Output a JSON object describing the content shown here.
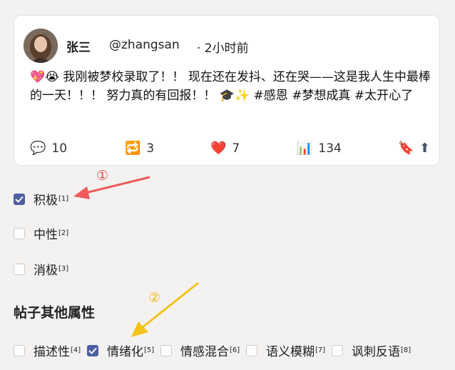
{
  "post": {
    "author_name": "张三",
    "handle": "@zhangsan",
    "time": "· 2小时前",
    "emojis_start": "💖😭",
    "text": " 我刚被梦校录取了！！ 现在还在发抖、还在哭——这是我人生中最棒的一天！！！ 努力真的有回报！！ 🎓✨ #感恩 #梦想成真 #太开心了",
    "actions": {
      "reply_icon": "💬",
      "reply_count": "10",
      "retweet_icon": "🔁",
      "retweet_count": "3",
      "like_icon": "❤️",
      "like_count": "7",
      "views_icon": "📊",
      "views_count": "134",
      "bookmark_icon": "🔖",
      "share_icon": "⬆"
    }
  },
  "sentiment": [
    {
      "label": "积极",
      "ref": "[1]",
      "checked": true
    },
    {
      "label": "中性",
      "ref": "[2]",
      "checked": false
    },
    {
      "label": "消极",
      "ref": "[3]",
      "checked": false
    }
  ],
  "other_title": "帖子其他属性",
  "other": [
    {
      "label": "描述性",
      "ref": "[4]",
      "checked": false
    },
    {
      "label": "情绪化",
      "ref": "[5]",
      "checked": true
    },
    {
      "label": "情感混合",
      "ref": "[6]",
      "checked": false
    },
    {
      "label": "语义模糊",
      "ref": "[7]",
      "checked": false
    },
    {
      "label": "讽刺反语",
      "ref": "[8]",
      "checked": false
    }
  ],
  "annotations": {
    "one": "①",
    "two": "②"
  },
  "colors": {
    "checkbox_checked": "#4c5fa3",
    "arrow_one": "#f05a5a",
    "arrow_two": "#f5c21a"
  }
}
